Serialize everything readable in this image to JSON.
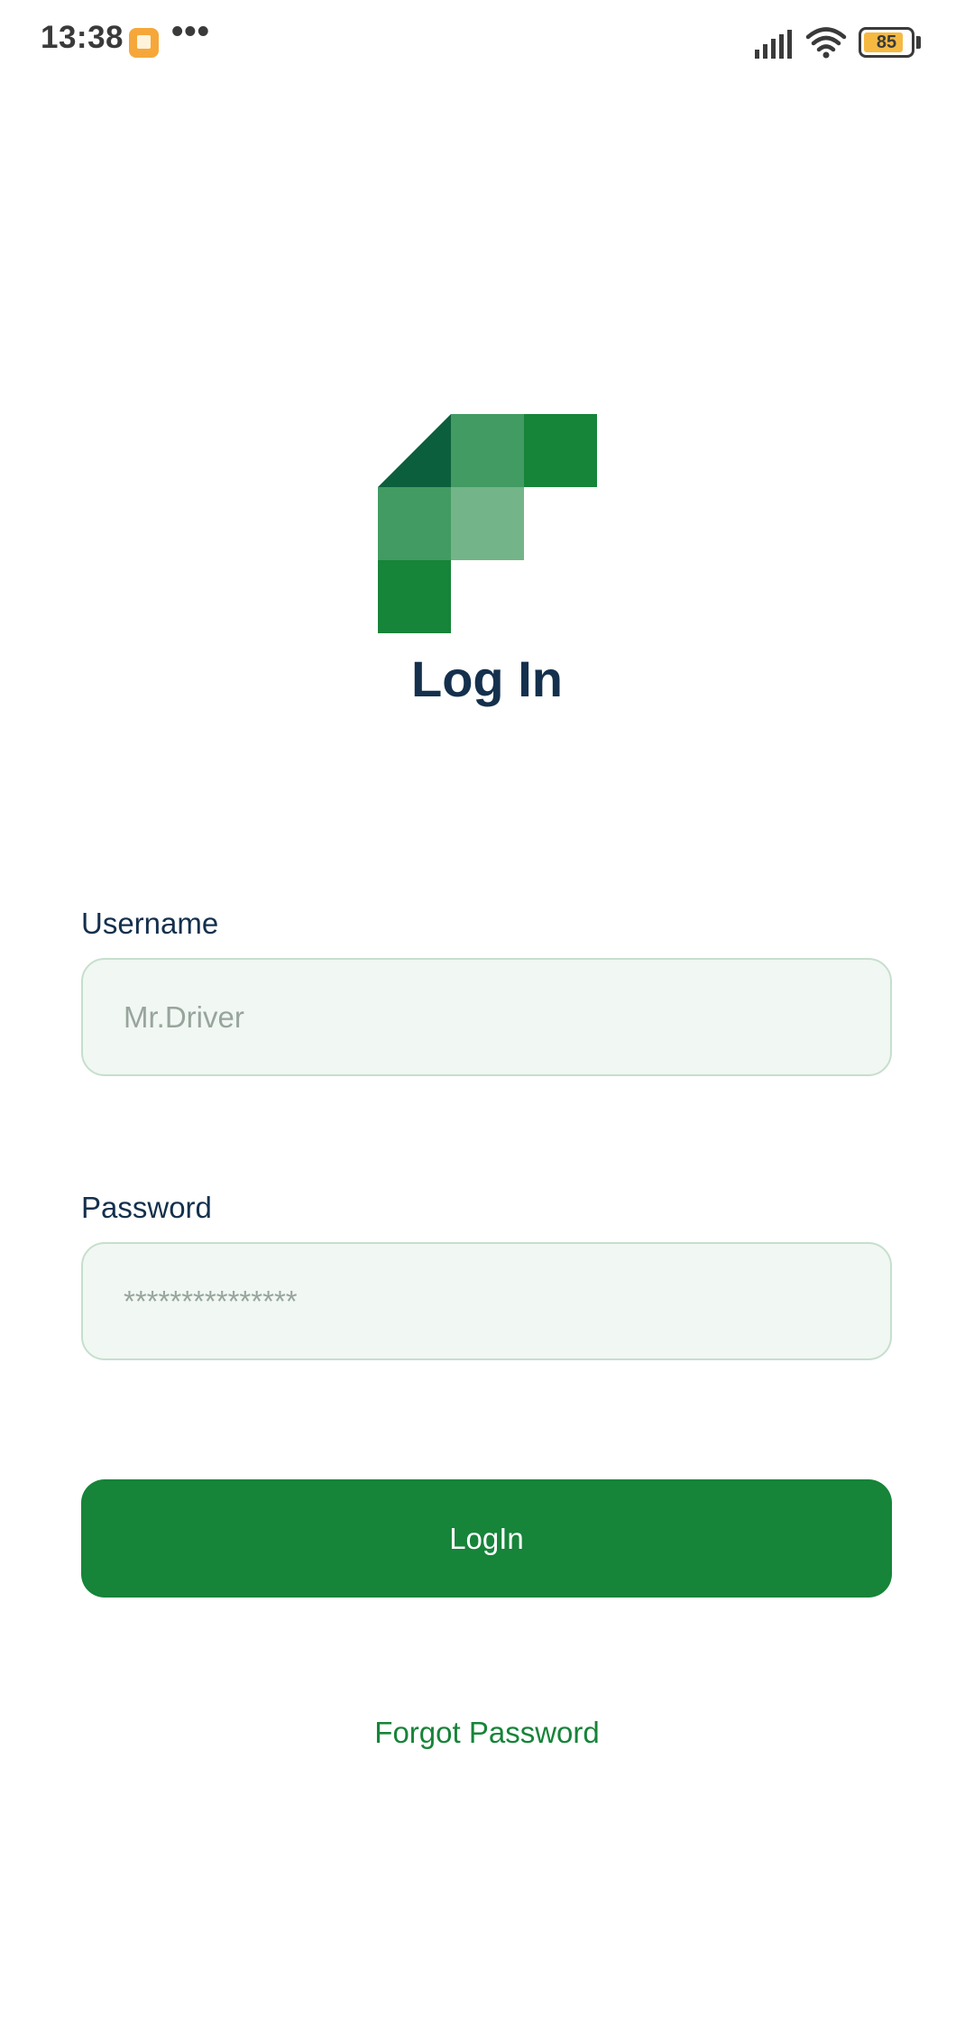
{
  "status_bar": {
    "time": "13:38",
    "more": "•••",
    "battery_level": "85",
    "icons": [
      "notification-icon",
      "signal-icon",
      "wifi-icon",
      "battery-icon"
    ]
  },
  "logo": {
    "icon": "app-logo-icon",
    "colors": {
      "dark": "#0b5f3c",
      "medium": "#429b62",
      "primary": "#168439",
      "light": "#73b588"
    }
  },
  "title": "Log In",
  "form": {
    "username": {
      "label": "Username",
      "placeholder": "Mr.Driver"
    },
    "password": {
      "label": "Password",
      "placeholder": "***************"
    },
    "submit_label": "LogIn",
    "forgot_label": "Forgot Password"
  },
  "colors": {
    "accent": "#168439",
    "title": "#14304d",
    "input_bg": "#f1f7f3",
    "input_border": "#c6dfcd",
    "placeholder": "#98a59c"
  }
}
